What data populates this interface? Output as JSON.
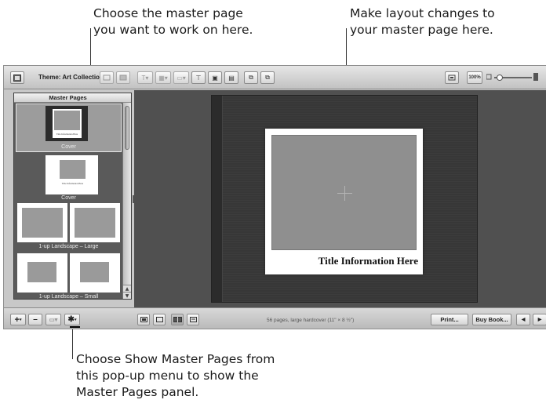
{
  "callouts": {
    "top_left": [
      "Choose the master page",
      "you want to work on here."
    ],
    "top_right": [
      "Make layout changes to",
      "your master page here."
    ],
    "bottom": [
      "Choose Show Master Pages from",
      "this pop-up menu to show the",
      "Master Pages panel."
    ]
  },
  "toolbar": {
    "theme_label": "Theme: Art Collection",
    "zoom_label": "100%"
  },
  "sidebar": {
    "header": "Master Pages",
    "thumbs": [
      {
        "label": "Cover",
        "caption": "Title Information Here",
        "selected": true
      },
      {
        "label": "Cover",
        "caption": "Title Information Here",
        "selected": false
      },
      {
        "label": "1-up Landscape – Large",
        "selected": false
      },
      {
        "label": "1-up Landscape – Small",
        "selected": false
      }
    ]
  },
  "canvas": {
    "title_text": "Title Information Here"
  },
  "bottombar": {
    "status": "56 pages, large hardcover (11\" × 8 ½\")",
    "print_label": "Print...",
    "buy_label": "Buy Book...",
    "add_symbol": "+",
    "remove_symbol": "–",
    "prev_symbol": "◀",
    "next_symbol": "▶"
  },
  "colors": {
    "window_bg": "#c8c8c8",
    "canvas_bg": "#505050",
    "book_cover": "#373737",
    "sidebar_bg": "#5a5a5a"
  }
}
